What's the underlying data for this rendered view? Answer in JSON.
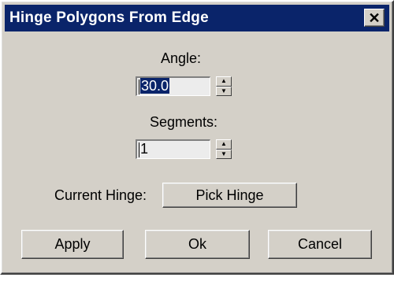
{
  "window": {
    "title": "Hinge Polygons From Edge",
    "close_symbol": "✕",
    "titlebar_color": "#0a246a",
    "face_color": "#d4d0c8"
  },
  "angle": {
    "label": "Angle:",
    "value": "30.0",
    "spinner_up_icon": "triangle-up",
    "spinner_down_icon": "triangle-down"
  },
  "segments": {
    "label": "Segments:",
    "value": "1"
  },
  "hinge": {
    "label": "Current Hinge:",
    "pick_button": "Pick Hinge"
  },
  "buttons": {
    "apply": "Apply",
    "ok": "Ok",
    "cancel": "Cancel"
  }
}
